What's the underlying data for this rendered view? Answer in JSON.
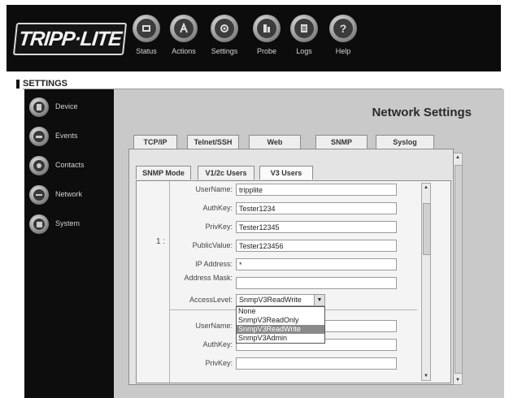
{
  "brand": {
    "logo_text": "TRIPP·LITE"
  },
  "top_nav": [
    {
      "label": "Status",
      "icon": "status-icon"
    },
    {
      "label": "Actions",
      "icon": "actions-icon"
    },
    {
      "label": "Settings",
      "icon": "settings-icon"
    },
    {
      "label": "Probe",
      "icon": "probe-icon"
    },
    {
      "label": "Logs",
      "icon": "logs-icon"
    },
    {
      "label": "Help",
      "icon": "help-icon"
    }
  ],
  "section_header": "SETTINGS",
  "sidebar": {
    "items": [
      {
        "label": "Device",
        "icon": "device-icon"
      },
      {
        "label": "Events",
        "icon": "events-icon"
      },
      {
        "label": "Contacts",
        "icon": "contacts-icon"
      },
      {
        "label": "Network",
        "icon": "network-icon"
      },
      {
        "label": "System",
        "icon": "system-icon"
      }
    ]
  },
  "page_title": "Network Settings",
  "tabs": [
    "TCP/IP",
    "Telnet/SSH",
    "Web",
    "SNMP",
    "Syslog"
  ],
  "subtabs": [
    "SNMP Mode",
    "V1/2c Users",
    "V3 Users"
  ],
  "user1": {
    "index": "1 :",
    "fields": [
      {
        "label": "UserName:",
        "value": "tripplite"
      },
      {
        "label": "AuthKey:",
        "value": "Tester1234"
      },
      {
        "label": "PrivKey:",
        "value": "Tester12345"
      },
      {
        "label": "PublicValue:",
        "value": "Tester123456"
      },
      {
        "label": "IP Address:",
        "value": "*"
      },
      {
        "label": "Address Mask:",
        "value": ""
      }
    ],
    "access_level": {
      "label": "AccessLevel:",
      "value": "SnmpV3ReadWrite"
    }
  },
  "access_level_options": [
    "None",
    "SnmpV3ReadOnly",
    "SnmpV3ReadWrite",
    "SnmpV3Admin"
  ],
  "access_level_selected_index": 2,
  "user2": {
    "fields": [
      {
        "label": "UserName:",
        "value": ""
      },
      {
        "label": "AuthKey:",
        "value": ""
      },
      {
        "label": "PrivKey:",
        "value": ""
      }
    ]
  },
  "colors": {
    "banner": "#0c0c0c",
    "sidebar": "#0d0d0d",
    "content_bg": "#c9c9c9",
    "dropdown_highlight": "#8a8a8a"
  }
}
